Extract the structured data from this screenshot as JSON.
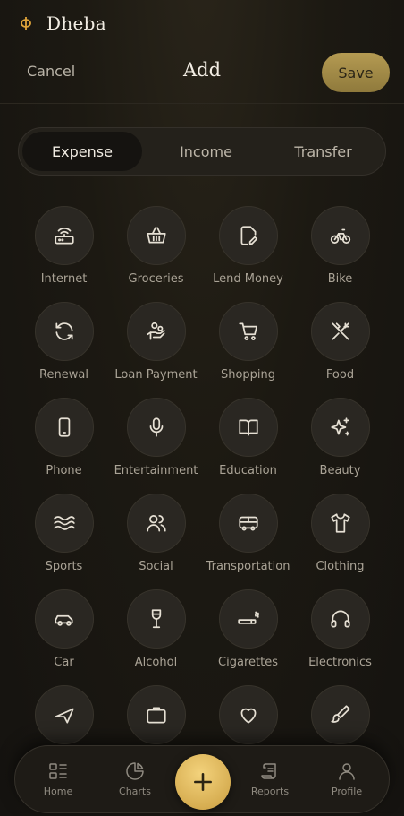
{
  "app": {
    "brand": "Dheba"
  },
  "header": {
    "cancel_label": "Cancel",
    "title": "Add",
    "save_label": "Save"
  },
  "tabs": [
    {
      "label": "Expense",
      "active": true
    },
    {
      "label": "Income",
      "active": false
    },
    {
      "label": "Transfer",
      "active": false
    }
  ],
  "categories": [
    {
      "label": "Internet",
      "icon": "router-icon"
    },
    {
      "label": "Groceries",
      "icon": "basket-icon"
    },
    {
      "label": "Lend Money",
      "icon": "document-edit-icon"
    },
    {
      "label": "Bike",
      "icon": "bike-icon"
    },
    {
      "label": "Renewal",
      "icon": "refresh-icon"
    },
    {
      "label": "Loan Payment",
      "icon": "hand-coins-icon"
    },
    {
      "label": "Shopping",
      "icon": "shopping-cart-icon"
    },
    {
      "label": "Food",
      "icon": "utensils-icon"
    },
    {
      "label": "Phone",
      "icon": "phone-icon"
    },
    {
      "label": "Entertainment",
      "icon": "microphone-icon"
    },
    {
      "label": "Education",
      "icon": "book-icon"
    },
    {
      "label": "Beauty",
      "icon": "sparkles-icon"
    },
    {
      "label": "Sports",
      "icon": "waves-icon"
    },
    {
      "label": "Social",
      "icon": "users-icon"
    },
    {
      "label": "Transportation",
      "icon": "bus-icon"
    },
    {
      "label": "Clothing",
      "icon": "shirt-icon"
    },
    {
      "label": "Car",
      "icon": "car-icon"
    },
    {
      "label": "Alcohol",
      "icon": "wine-glass-icon"
    },
    {
      "label": "Cigarettes",
      "icon": "cigarette-icon"
    },
    {
      "label": "Electronics",
      "icon": "headphones-icon"
    }
  ],
  "nav": {
    "home_label": "Home",
    "charts_label": "Charts",
    "reports_label": "Reports",
    "profile_label": "Profile",
    "add_icon": "plus-icon"
  },
  "colors": {
    "accent": "#d7ae52",
    "save_button": "#a88f49",
    "background": "#17150f"
  }
}
